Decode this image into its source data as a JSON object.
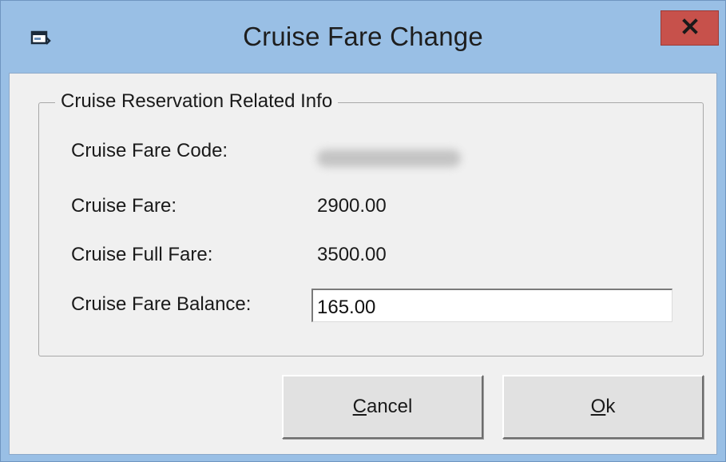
{
  "window": {
    "title": "Cruise Fare Change",
    "close_label": "x"
  },
  "group": {
    "legend": "Cruise Reservation Related Info",
    "fields": [
      {
        "label": "Cruise Fare Code:",
        "value": ""
      },
      {
        "label": "Cruise Fare:",
        "value": "2900.00"
      },
      {
        "label": "Cruise Full Fare:",
        "value": "3500.00"
      },
      {
        "label": "Cruise Fare Balance:",
        "value": "165.00"
      }
    ]
  },
  "buttons": {
    "cancel": {
      "mnemonic": "C",
      "rest": "ancel"
    },
    "ok": {
      "mnemonic": "O",
      "rest": "k"
    }
  },
  "icons": {
    "app": "window-app-icon",
    "close": "close-icon"
  },
  "colors": {
    "titlebar": "#99bfe5",
    "close_button": "#c7514b",
    "client_background": "#f0f0f0"
  }
}
